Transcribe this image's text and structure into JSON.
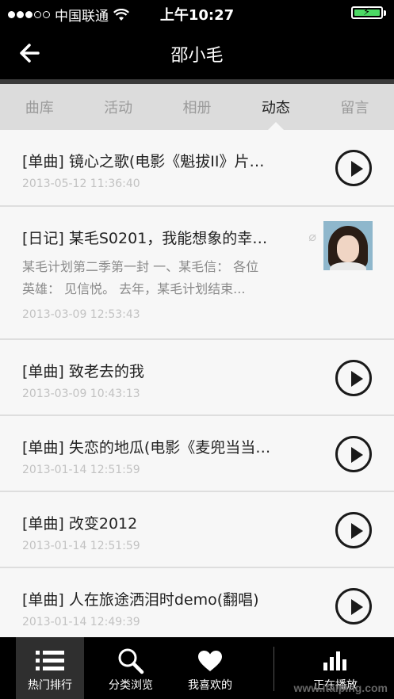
{
  "status_bar": {
    "carrier": "中国联通",
    "time": "上午10:27"
  },
  "nav": {
    "title": "邵小毛"
  },
  "tabs": [
    {
      "label": "曲库",
      "active": false
    },
    {
      "label": "活动",
      "active": false
    },
    {
      "label": "相册",
      "active": false
    },
    {
      "label": "动态",
      "active": true
    },
    {
      "label": "留言",
      "active": false
    }
  ],
  "feed": [
    {
      "title": "[单曲] 镜心之歌(电影《魁拔II》片…",
      "date": "2013-05-12 11:36:40"
    },
    {
      "title": "[日记] 某毛S0201，我能想象的幸…",
      "excerpt_line1": "某毛计划第二季第一封 一、某毛信： 各位",
      "excerpt_line2": "英雄： 见信悦。 去年，某毛计划结束...",
      "date": "2013-03-09 12:53:43"
    },
    {
      "title": "[单曲] 致老去的我",
      "date": "2013-03-09 10:43:13"
    },
    {
      "title": "[单曲] 失恋的地瓜(电影《麦兜当当…",
      "date": "2013-01-14 12:51:59"
    },
    {
      "title": "[单曲] 改变2012",
      "date": "2013-01-14 12:51:59"
    },
    {
      "title": "[单曲] 人在旅途洒泪时demo(翻唱)",
      "date": "2013-01-14 12:49:39"
    }
  ],
  "tabbar": {
    "items": [
      {
        "label": "热门排行",
        "icon": "list-icon"
      },
      {
        "label": "分类浏览",
        "icon": "search-icon"
      },
      {
        "label": "我喜欢的",
        "icon": "heart-icon"
      },
      {
        "label": "正在播放",
        "icon": "bars-icon"
      }
    ]
  },
  "watermark": "www.itaiping.com"
}
